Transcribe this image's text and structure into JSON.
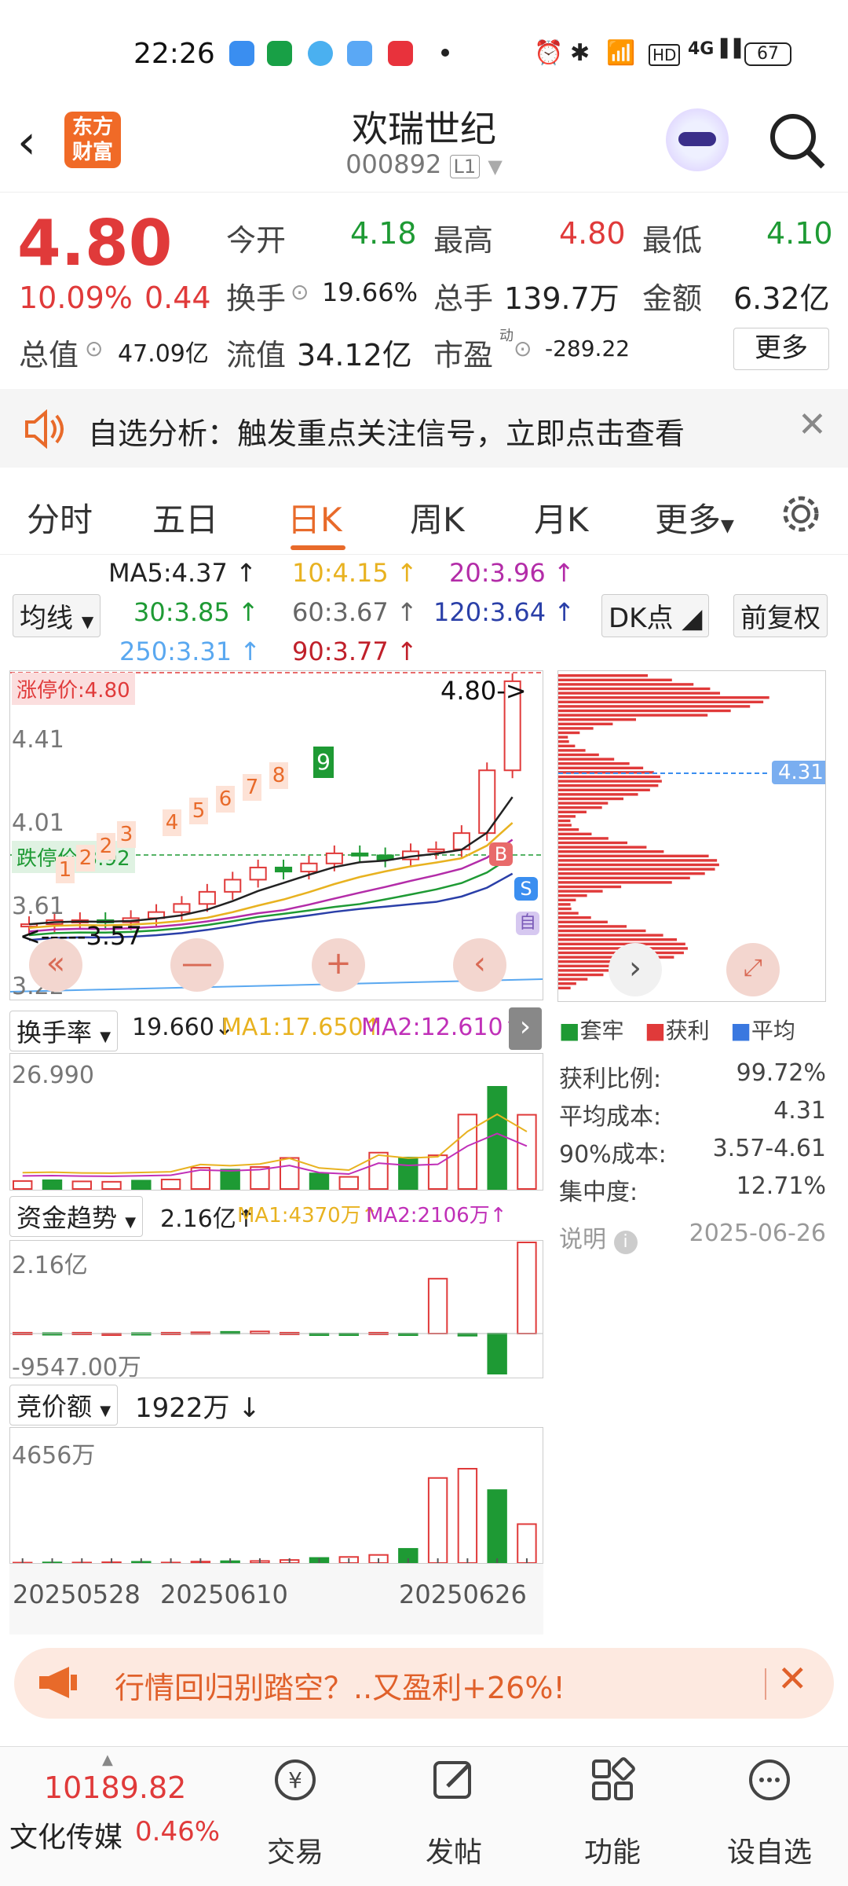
{
  "status": {
    "time": "22:26",
    "battery": "67"
  },
  "header": {
    "title": "欢瑞世纪",
    "code": "000892",
    "level": "L1",
    "logo_line1": "东方",
    "logo_line2": "财富"
  },
  "quote": {
    "price": "4.80",
    "change_pct": "10.09%",
    "change": "0.44",
    "open_label": "今开",
    "open": "4.18",
    "high_label": "最高",
    "high": "4.80",
    "low_label": "最低",
    "low": "4.10",
    "turnover_label": "换手",
    "turnover": "19.66%",
    "volume_label": "总手",
    "volume": "139.7万",
    "amount_label": "金额",
    "amount": "6.32亿",
    "mktcap_label": "总值",
    "mktcap": "47.09亿",
    "float_label": "流值",
    "float": "34.12亿",
    "pe_label": "市盈",
    "pe_sup": "动",
    "pe": "-289.22",
    "more": "更多"
  },
  "banner": {
    "text": "自选分析：触发重点关注信号，立即点击查看"
  },
  "tabs": [
    "分时",
    "五日",
    "日K",
    "周K",
    "月K",
    "更多"
  ],
  "active_tab": "日K",
  "ma": {
    "selector": "均线",
    "ma5": "MA5:4.37",
    "ma10": "10:4.15",
    "ma20": "20:3.96",
    "ma30": "30:3.85",
    "ma60": "60:3.67",
    "ma120": "120:3.64",
    "ma250": "250:3.31",
    "ma90": "90:3.77",
    "dk": "DK点",
    "adjust": "前复权"
  },
  "chart": {
    "limit_up": "涨停价:4.80",
    "limit_down": "跌停价:3.92",
    "y_top": "4.80",
    "y_mid": "4.41",
    "y_low": "4.01",
    "y_l2": "3.61",
    "y_bottom": "3.22",
    "last_price": "4.80->",
    "low_mark": "<-----3.57",
    "b_mark": "B",
    "s_mark": "S",
    "self_mark": "自",
    "nine": "9",
    "counts": [
      "1",
      "2",
      "2",
      "3",
      "4",
      "5",
      "6",
      "7",
      "8"
    ],
    "cost_line": "4.31"
  },
  "chart_data": {
    "type": "candlestick",
    "prices": [
      3.6,
      3.62,
      3.62,
      3.61,
      3.63,
      3.66,
      3.7,
      3.76,
      3.82,
      3.88,
      3.86,
      3.9,
      3.95,
      3.94,
      3.92,
      3.96,
      3.97,
      4.05,
      4.36,
      4.8
    ],
    "turnover": [
      2.1,
      2.3,
      2.0,
      1.9,
      2.2,
      2.5,
      5.6,
      5.1,
      5.8,
      8.2,
      4.1,
      3.2,
      9.6,
      8.3,
      8.9,
      19.66,
      26.99,
      19.6
    ],
    "funds_yi": [
      0.02,
      0.01,
      0.02,
      0.0,
      0.01,
      0.02,
      0.03,
      0.04,
      0.05,
      0.02,
      -0.02,
      -0.01,
      0.02,
      0.0,
      1.3,
      -0.05,
      -0.95,
      2.16
    ],
    "auction_wan": [
      20,
      30,
      25,
      40,
      60,
      25,
      70,
      90,
      100,
      150,
      250,
      300,
      400,
      700,
      4200,
      4656,
      3600,
      1922
    ]
  },
  "ind1": {
    "name": "换手率",
    "value": "19.660",
    "ma1": "MA1:17.650",
    "ma2": "MA2:12.610",
    "top": "26.990"
  },
  "ind2": {
    "name": "资金趋势",
    "value": "2.16亿",
    "ma1": "MA1:4370万",
    "ma2": "MA2:2106万",
    "top": "2.16亿",
    "bottom": "-9547.00万"
  },
  "ind3": {
    "name": "竞价额",
    "value": "1922万",
    "top": "4656万"
  },
  "dates": [
    "20250528",
    "20250610",
    "20250626"
  ],
  "dist": {
    "legend": [
      "套牢",
      "获利",
      "平均"
    ],
    "ratio_label": "获利比例:",
    "ratio": "99.72%",
    "avg_label": "平均成本:",
    "avg": "4.31",
    "c90_label": "90%成本:",
    "c90": "3.57-4.61",
    "conc_label": "集中度:",
    "conc": "12.71%",
    "note": "说明",
    "date": "2025-06-26"
  },
  "ad": {
    "text": "行情回归别踏空？..又盈利+26%!"
  },
  "bottom": {
    "index_value": "10189.82",
    "index_name": "文化传媒",
    "index_pct": "0.46%",
    "trade": "交易",
    "post": "发帖",
    "func": "功能",
    "watch": "设自选"
  }
}
